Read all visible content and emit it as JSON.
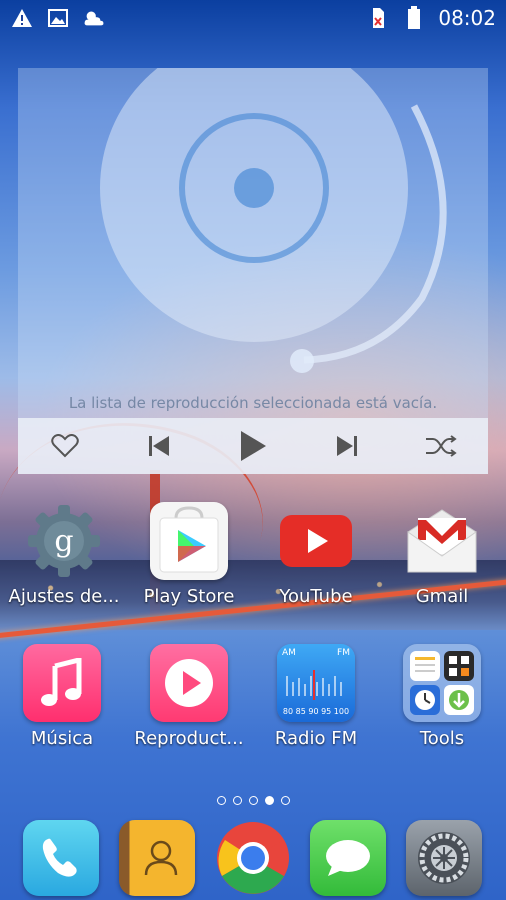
{
  "status_bar": {
    "time": "08:02",
    "left_icons": [
      "warning-icon",
      "image-icon",
      "weather-icon"
    ],
    "right_icons": [
      "no-sim-icon",
      "battery-icon"
    ]
  },
  "music_widget": {
    "empty_message": "La lista de reproducción seleccionada está vacía.",
    "controls": [
      "heart-icon",
      "previous-icon",
      "play-icon",
      "next-icon",
      "shuffle-icon"
    ]
  },
  "apps_row1": [
    {
      "label": "Ajustes de...",
      "icon": "google-settings-icon"
    },
    {
      "label": "Play Store",
      "icon": "play-store-icon"
    },
    {
      "label": "YouTube",
      "icon": "youtube-icon"
    },
    {
      "label": "Gmail",
      "icon": "gmail-icon"
    }
  ],
  "apps_row2": [
    {
      "label": "Música",
      "icon": "music-note-icon"
    },
    {
      "label": "Reproduct...",
      "icon": "video-play-icon"
    },
    {
      "label": "Radio FM",
      "icon": "radio-icon"
    },
    {
      "label": "Tools",
      "icon": "tools-folder-icon"
    }
  ],
  "radio_icon_text": {
    "am": "AM",
    "fm": "FM",
    "scale": "80 85 90 95 100"
  },
  "page_indicator": {
    "pages": 5,
    "current": 4
  },
  "dock": [
    "phone-icon",
    "contacts-icon",
    "chrome-icon",
    "messages-icon",
    "settings-icon"
  ],
  "colors": {
    "youtube": "#e52d27",
    "music": "#ff3f7f",
    "phone": "#3fc6e8",
    "messages": "#4cd04c",
    "contacts": "#f4b52e"
  }
}
